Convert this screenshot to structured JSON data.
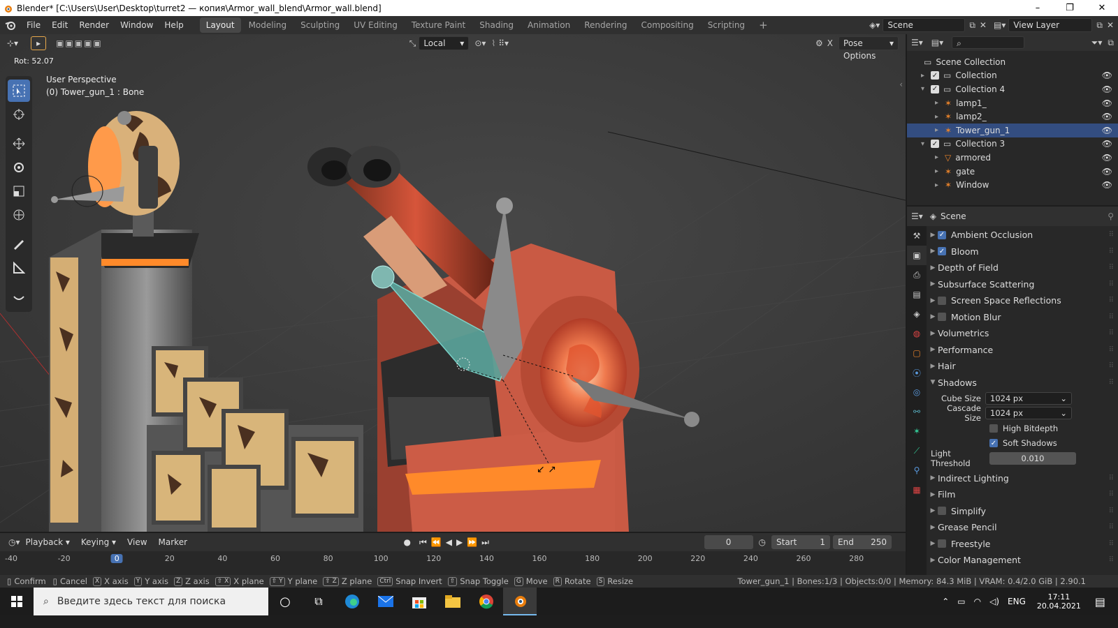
{
  "window": {
    "title": "Blender* [C:\\Users\\User\\Desktop\\turret2 — копия\\Armor_wall_blend\\Armor_wall.blend]",
    "minimize": "–",
    "maximize": "❐",
    "close": "✕"
  },
  "menus": [
    "File",
    "Edit",
    "Render",
    "Window",
    "Help"
  ],
  "workspaces": [
    "Layout",
    "Modeling",
    "Sculpting",
    "UV Editing",
    "Texture Paint",
    "Shading",
    "Animation",
    "Rendering",
    "Compositing",
    "Scripting"
  ],
  "add_workspace": "+",
  "scene_field": "Scene",
  "view_layer_field": "View Layer",
  "viewport": {
    "orientation": "Local",
    "pose_options": "Pose Options",
    "rot_readout": "Rot: 52.07",
    "perspective": "User Perspective",
    "active_info": "(0) Tower_gun_1 : Bone"
  },
  "outliner": {
    "root": "Scene Collection",
    "rows": [
      {
        "label": "Collection",
        "indent": 1,
        "expander": "▸",
        "kind": "collection"
      },
      {
        "label": "Collection 4",
        "indent": 1,
        "expander": "▾",
        "kind": "collection"
      },
      {
        "label": "lamp1_",
        "indent": 2,
        "expander": "▸",
        "kind": "armature"
      },
      {
        "label": "lamp2_",
        "indent": 2,
        "expander": "▸",
        "kind": "armature"
      },
      {
        "label": "Tower_gun_1",
        "indent": 2,
        "expander": "▸",
        "kind": "armature",
        "selected": true
      },
      {
        "label": "Collection 3",
        "indent": 1,
        "expander": "▾",
        "kind": "collection"
      },
      {
        "label": "armored",
        "indent": 2,
        "expander": "▸",
        "kind": "mesh"
      },
      {
        "label": "gate",
        "indent": 2,
        "expander": "▸",
        "kind": "armature"
      },
      {
        "label": "Window",
        "indent": 2,
        "expander": "▸",
        "kind": "armature"
      }
    ]
  },
  "properties": {
    "context": "Scene",
    "panels": [
      {
        "label": "Ambient Occlusion",
        "checkbox": true,
        "checked": true
      },
      {
        "label": "Bloom",
        "checkbox": true,
        "checked": true
      },
      {
        "label": "Depth of Field",
        "checkbox": false
      },
      {
        "label": "Subsurface Scattering",
        "checkbox": false
      },
      {
        "label": "Screen Space Reflections",
        "checkbox": true,
        "checked": false
      },
      {
        "label": "Motion Blur",
        "checkbox": true,
        "checked": false
      },
      {
        "label": "Volumetrics",
        "checkbox": false
      },
      {
        "label": "Performance",
        "checkbox": false
      },
      {
        "label": "Hair",
        "checkbox": false
      }
    ],
    "shadows": {
      "label": "Shadows",
      "cube_size_label": "Cube Size",
      "cube_size": "1024 px",
      "cascade_size_label": "Cascade Size",
      "cascade_size": "1024 px",
      "high_bitdepth": "High Bitdepth",
      "soft_shadows": "Soft Shadows",
      "light_threshold_label": "Light Threshold",
      "light_threshold": "0.010"
    },
    "panels_after": [
      {
        "label": "Indirect Lighting",
        "checkbox": false
      },
      {
        "label": "Film",
        "checkbox": false
      },
      {
        "label": "Simplify",
        "checkbox": true,
        "checked": false
      },
      {
        "label": "Grease Pencil",
        "checkbox": false
      },
      {
        "label": "Freestyle",
        "checkbox": true,
        "checked": false
      },
      {
        "label": "Color Management",
        "checkbox": false
      }
    ]
  },
  "timeline": {
    "menus": [
      "Playback",
      "Keying",
      "View",
      "Marker"
    ],
    "current_frame": "0",
    "start_label": "Start",
    "start": "1",
    "end_label": "End",
    "end": "250",
    "ticks": [
      "-40",
      "-20",
      "0",
      "20",
      "40",
      "60",
      "80",
      "100",
      "120",
      "140",
      "160",
      "180",
      "200",
      "220",
      "240",
      "260",
      "280"
    ]
  },
  "statusbar": {
    "hints": [
      {
        "key": "",
        "label": "Confirm"
      },
      {
        "key": "",
        "label": "Cancel"
      },
      {
        "key": "X",
        "label": "X axis"
      },
      {
        "key": "Y",
        "label": "Y axis"
      },
      {
        "key": "Z",
        "label": "Z axis"
      },
      {
        "key": "⇧ X",
        "label": "X plane"
      },
      {
        "key": "⇧ Y",
        "label": "Y plane"
      },
      {
        "key": "⇧ Z",
        "label": "Z plane"
      },
      {
        "key": "Ctrl",
        "label": "Snap Invert"
      },
      {
        "key": "⇧",
        "label": "Snap Toggle"
      },
      {
        "key": "G",
        "label": "Move"
      },
      {
        "key": "R",
        "label": "Rotate"
      },
      {
        "key": "S",
        "label": "Resize"
      }
    ],
    "info": "Tower_gun_1 | Bones:1/3 | Objects:0/0 | Memory: 84.3 MiB | VRAM: 0.4/2.0 GiB | 2.90.1"
  },
  "taskbar": {
    "search_placeholder": "Введите здесь текст для поиска",
    "lang": "ENG",
    "time": "17:11",
    "date": "20.04.2021"
  }
}
